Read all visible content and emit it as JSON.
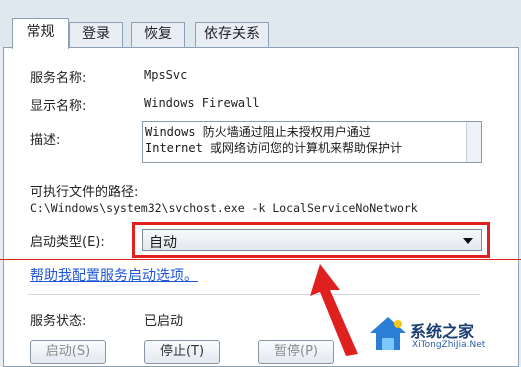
{
  "tabs": [
    {
      "label": "常规",
      "active": true
    },
    {
      "label": "登录",
      "active": false
    },
    {
      "label": "恢复",
      "active": false
    },
    {
      "label": "依存关系",
      "active": false
    }
  ],
  "service_name": {
    "label": "服务名称:",
    "value": "MpsSvc"
  },
  "display_name": {
    "label": "显示名称:",
    "value": "Windows Firewall"
  },
  "description": {
    "label": "描述:",
    "value": "Windows 防火墙通过阻止未授权用户通过\nInternet 或网络访问您的计算机来帮助保护计"
  },
  "exec_path": {
    "label": "可执行文件的路径:",
    "value": "C:\\Windows\\system32\\svchost.exe -k LocalServiceNoNetwork"
  },
  "startup_type": {
    "label": "启动类型(E):",
    "value": "自动"
  },
  "help_link": "帮助我配置服务启动选项。",
  "service_status": {
    "label": "服务状态:",
    "value": "已启动"
  },
  "buttons": {
    "start": "启动(S)",
    "stop": "停止(T)",
    "pause": "暂停(P)"
  },
  "watermark": {
    "text": "系统之家",
    "sub": "XiTongZhiJia.Net"
  },
  "colors": {
    "highlight_red": "#e0201e",
    "link_blue": "#1f56d8",
    "panel_border": "#8ea0b4"
  }
}
